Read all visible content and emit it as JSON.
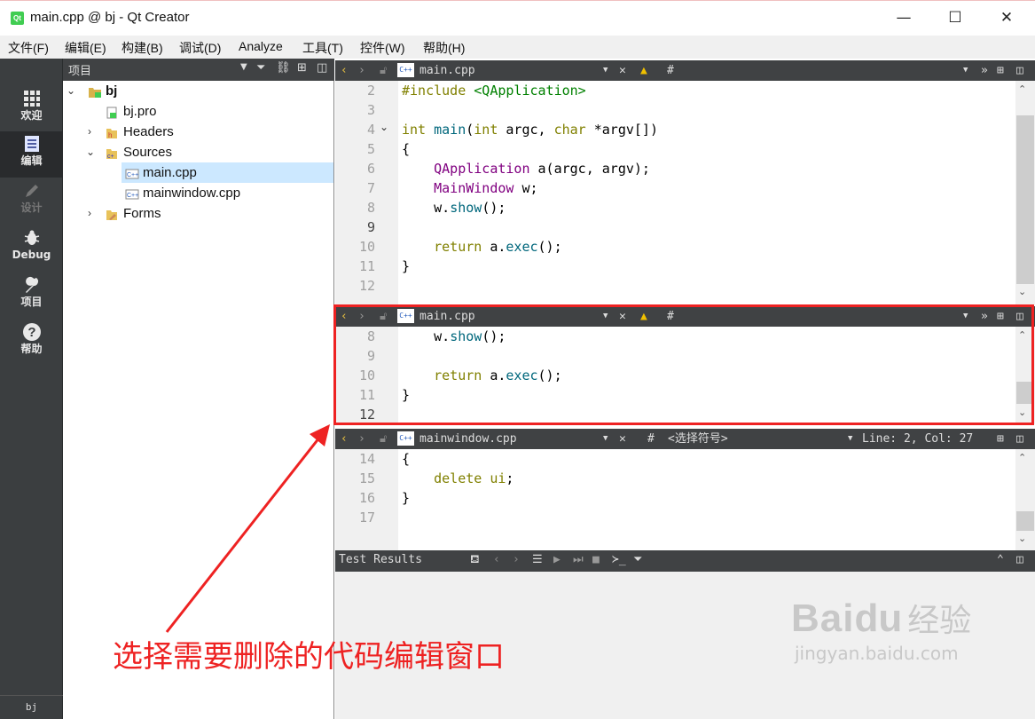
{
  "window": {
    "title": "main.cpp @ bj - Qt Creator",
    "app_icon": "Qt",
    "minimize": "—",
    "maximize": "☐",
    "close": "✕"
  },
  "menu": [
    "文件(F)",
    "编辑(E)",
    "构建(B)",
    "调试(D)",
    "Analyze",
    "工具(T)",
    "控件(W)",
    "帮助(H)"
  ],
  "modes": [
    {
      "label": "欢迎",
      "icon": "grid-icon"
    },
    {
      "label": "编辑",
      "icon": "document-icon"
    },
    {
      "label": "设计",
      "icon": "pencil-icon"
    },
    {
      "label": "Debug",
      "icon": "bug-icon"
    },
    {
      "label": "项目",
      "icon": "wrench-icon"
    },
    {
      "label": "帮助",
      "icon": "help-icon"
    }
  ],
  "mode_bottom": "bj",
  "project": {
    "title": "项目",
    "tree": [
      {
        "label": "bj",
        "level": 0,
        "expanded": true
      },
      {
        "label": "bj.pro",
        "level": 1
      },
      {
        "label": "Headers",
        "level": 1,
        "expanded": false
      },
      {
        "label": "Sources",
        "level": 1,
        "expanded": true
      },
      {
        "label": "main.cpp",
        "level": 2,
        "selected": true
      },
      {
        "label": "mainwindow.cpp",
        "level": 2
      },
      {
        "label": "Forms",
        "level": 1,
        "expanded": false
      }
    ]
  },
  "editors": [
    {
      "file": "main.cpp",
      "hash": "#",
      "line_numbers": [
        "2",
        "3",
        "4",
        "5",
        "6",
        "7",
        "8",
        "9",
        "10",
        "11",
        "12"
      ],
      "current_line": "9",
      "lines": [
        [
          [
            "kw",
            "#include"
          ],
          [
            "",
            "&nbsp;"
          ],
          [
            "str",
            "<QApplication>"
          ]
        ],
        [],
        [
          [
            "kw",
            "int"
          ],
          [
            "",
            " "
          ],
          [
            "fn",
            "main"
          ],
          [
            "",
            "("
          ],
          [
            "kw",
            "int"
          ],
          [
            "",
            " argc, "
          ],
          [
            "kw",
            "char"
          ],
          [
            "",
            " *argv[])"
          ]
        ],
        [
          [
            "",
            "{"
          ]
        ],
        [
          [
            "",
            "    "
          ],
          [
            "ty",
            "QApplication"
          ],
          [
            "",
            " a(argc, argv);"
          ]
        ],
        [
          [
            "",
            "    "
          ],
          [
            "ty",
            "MainWindow"
          ],
          [
            "",
            " w;"
          ]
        ],
        [
          [
            "",
            "    w."
          ],
          [
            "fn",
            "show"
          ],
          [
            "",
            "();"
          ]
        ],
        [],
        [
          [
            "",
            "    "
          ],
          [
            "kw",
            "return"
          ],
          [
            "",
            " a."
          ],
          [
            "fn",
            "exec"
          ],
          [
            "",
            "();"
          ]
        ],
        [
          [
            "",
            "}"
          ]
        ],
        []
      ]
    },
    {
      "file": "main.cpp",
      "hash": "#",
      "line_numbers": [
        "8",
        "9",
        "10",
        "11",
        "12"
      ],
      "current_line": "12",
      "lines": [
        [
          [
            "",
            "    w."
          ],
          [
            "fn",
            "show"
          ],
          [
            "",
            "();"
          ]
        ],
        [],
        [
          [
            "",
            "    "
          ],
          [
            "kw",
            "return"
          ],
          [
            "",
            " a."
          ],
          [
            "fn",
            "exec"
          ],
          [
            "",
            "();"
          ]
        ],
        [
          [
            "",
            "}"
          ]
        ],
        []
      ]
    },
    {
      "file": "mainwindow.cpp",
      "hash": "#",
      "symbol": "<选择符号>",
      "position": "Line: 2, Col: 27",
      "line_numbers": [
        "14",
        "15",
        "16",
        "17"
      ],
      "lines": [
        [
          [
            "",
            "{"
          ]
        ],
        [
          [
            "",
            "    "
          ],
          [
            "kw",
            "delete"
          ],
          [
            "",
            " "
          ],
          [
            "kw",
            "ui"
          ],
          [
            "",
            ";"
          ]
        ],
        [
          [
            "",
            "}"
          ]
        ],
        []
      ]
    }
  ],
  "test_results": {
    "title": "Test Results"
  },
  "annotation": "选择需要删除的代码编辑窗口",
  "watermark": {
    "brand": "Bai",
    "brand2": "du",
    "cn": "经验",
    "url": "jingyan.baidu.com"
  },
  "colors": {
    "annotation": "#ee2222",
    "sidebar": "#3b3e40",
    "toolbar": "#404244"
  }
}
